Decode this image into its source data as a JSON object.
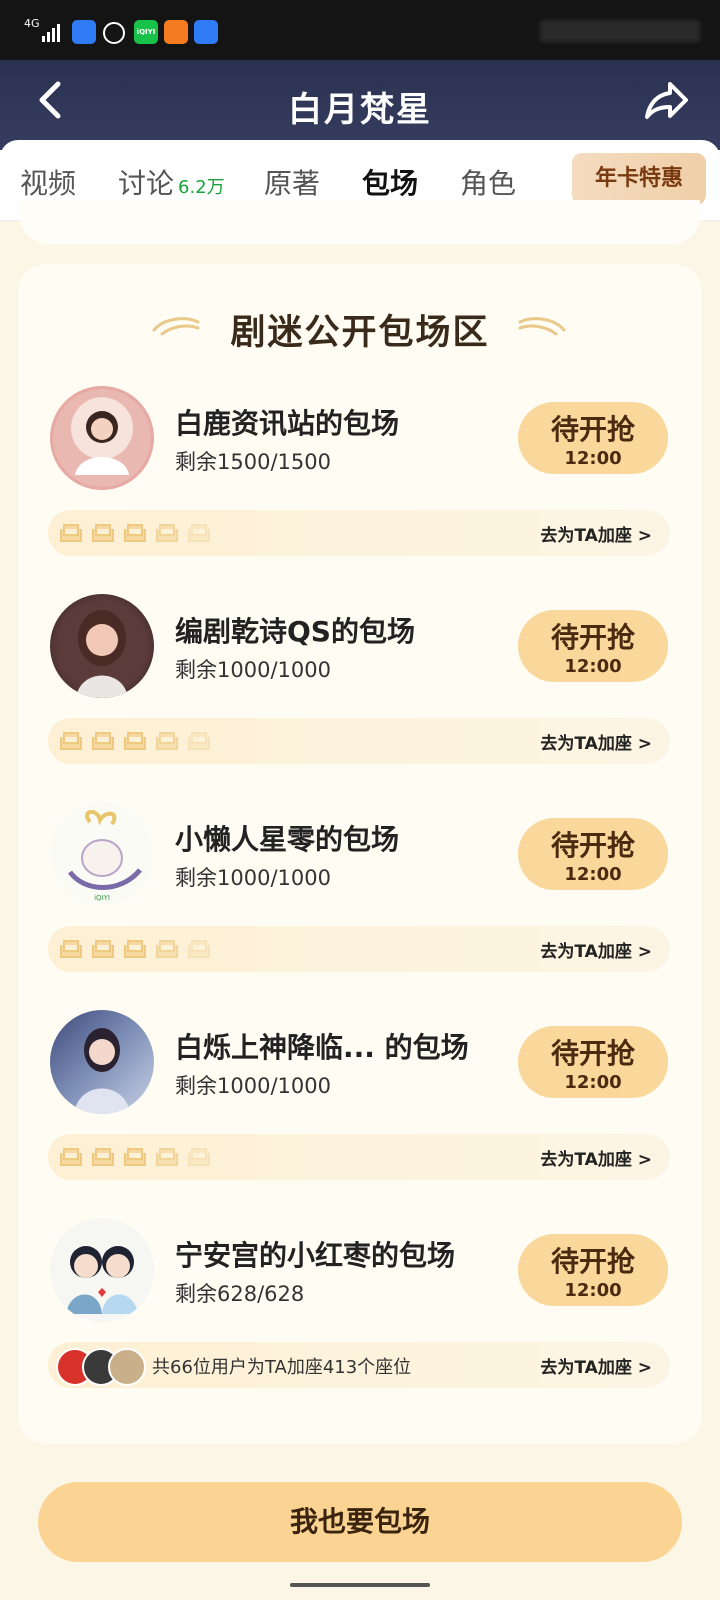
{
  "status_bar": {
    "network": "4G",
    "icons": [
      "shield-icon",
      "alarm-icon",
      "iqiyi-icon",
      "mail-icon",
      "shield-icon"
    ],
    "iqiyi_label": "iQIYI"
  },
  "header": {
    "title": "白月梵星",
    "back_icon": "chevron-left-icon",
    "share_icon": "share-icon"
  },
  "tabs": [
    {
      "label": "视频"
    },
    {
      "label": "讨论",
      "badge": "6.2万"
    },
    {
      "label": "原著"
    },
    {
      "label": "包场",
      "active": true
    },
    {
      "label": "角色"
    }
  ],
  "promo": {
    "label": "年卡特惠"
  },
  "section": {
    "title": "剧迷公开包场区"
  },
  "items": [
    {
      "name": "白鹿资讯站的包场",
      "remain": "剩余1500/1500",
      "button": "待开抢",
      "time": "12:00",
      "join": "去为TA加座 >"
    },
    {
      "name": "编剧乾诗QS的包场",
      "remain": "剩余1000/1000",
      "button": "待开抢",
      "time": "12:00",
      "join": "去为TA加座 >"
    },
    {
      "name": "小懒人星零的包场",
      "remain": "剩余1000/1000",
      "button": "待开抢",
      "time": "12:00",
      "join": "去为TA加座 >"
    },
    {
      "name": "白烁上神降临... 的包场",
      "remain": "剩余1000/1000",
      "button": "待开抢",
      "time": "12:00",
      "join": "去为TA加座 >"
    },
    {
      "name": "宁安宫的小红枣的包场",
      "remain": "剩余628/628",
      "button": "待开抢",
      "time": "12:00",
      "join": "去为TA加座 >",
      "summary": "共66位用户为TA加座413个座位"
    }
  ],
  "bottom": {
    "button": "我也要包场"
  },
  "colors": {
    "header": "#2a3150",
    "accent": "#fad79b",
    "badge": "#19a33b"
  }
}
